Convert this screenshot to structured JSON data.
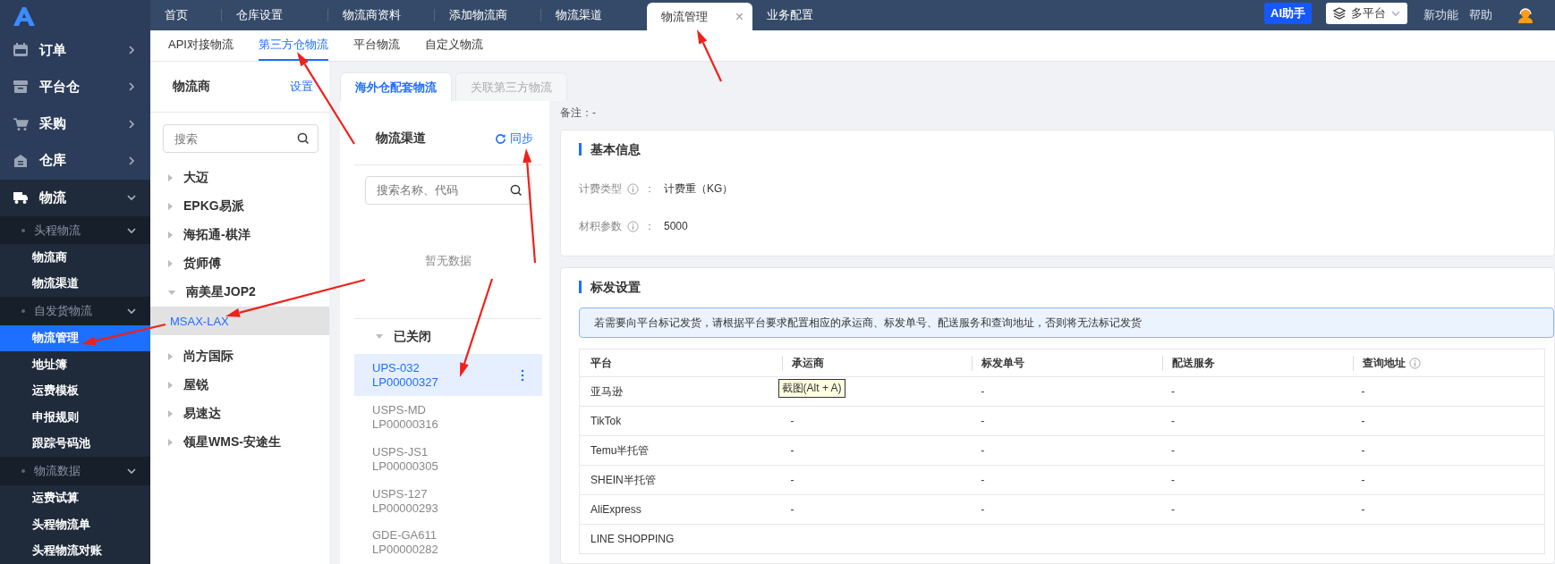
{
  "sidebar": {
    "items": [
      {
        "label": "订单",
        "expanded": false
      },
      {
        "label": "平台仓",
        "expanded": false
      },
      {
        "label": "采购",
        "expanded": false
      },
      {
        "label": "仓库",
        "expanded": false
      },
      {
        "label": "物流",
        "expanded": true,
        "children": [
          {
            "label": "头程物流",
            "expanded": true,
            "children": [
              {
                "label": "物流商",
                "selected": false
              },
              {
                "label": "物流渠道",
                "selected": false
              }
            ]
          },
          {
            "label": "自发货物流",
            "expanded": true,
            "children": [
              {
                "label": "物流管理",
                "selected": true
              },
              {
                "label": "地址簿",
                "selected": false
              },
              {
                "label": "运费模板",
                "selected": false
              },
              {
                "label": "申报规则",
                "selected": false
              },
              {
                "label": "跟踪号码池",
                "selected": false
              }
            ]
          },
          {
            "label": "物流数据",
            "expanded": true,
            "children": [
              {
                "label": "运费试算",
                "selected": false
              },
              {
                "label": "头程物流单",
                "selected": false
              },
              {
                "label": "头程物流对账",
                "selected": false
              }
            ]
          }
        ]
      }
    ]
  },
  "top_tabs": [
    {
      "label": "首页",
      "selected": false
    },
    {
      "label": "仓库设置",
      "selected": false
    },
    {
      "label": "物流商资料",
      "selected": false
    },
    {
      "label": "添加物流商",
      "selected": false
    },
    {
      "label": "物流渠道",
      "selected": false
    },
    {
      "label": "物流管理",
      "selected": true,
      "close": "×"
    },
    {
      "label": "业务配置",
      "selected": false
    }
  ],
  "header_actions": {
    "ai_button": "AI助手",
    "platform_select": "多平台",
    "links": [
      "新功能",
      "帮助"
    ]
  },
  "sub_tabs": [
    {
      "label": "API对接物流",
      "selected": false
    },
    {
      "label": "第三方仓物流",
      "selected": true
    },
    {
      "label": "平台物流",
      "selected": false
    },
    {
      "label": "自定义物流",
      "selected": false
    }
  ],
  "providers": {
    "title": "物流商",
    "settings_link": "设置",
    "search": {
      "placeholder": "搜索"
    },
    "items": [
      {
        "label": "大迈",
        "expanded": false
      },
      {
        "label": "EPKG易派",
        "expanded": false
      },
      {
        "label": "海拓通-棋洋",
        "expanded": false
      },
      {
        "label": "货师傅",
        "expanded": false
      },
      {
        "label": "南美星JOP2",
        "expanded": true,
        "children": [
          {
            "label": "MSAX-LAX",
            "selected": true
          }
        ]
      },
      {
        "label": "尚方国际",
        "expanded": false
      },
      {
        "label": "屋锐",
        "expanded": false
      },
      {
        "label": "易速达",
        "expanded": false
      },
      {
        "label": "领星WMS-安途生",
        "expanded": false
      }
    ]
  },
  "inner_tabs": [
    {
      "label": "海外仓配套物流",
      "selected": true
    },
    {
      "label": "关联第三方物流",
      "selected": false
    }
  ],
  "channels": {
    "title": "物流渠道",
    "sync_link": "同步",
    "search": {
      "placeholder": "搜索名称、代码"
    },
    "empty_text": "暂无数据",
    "group": {
      "label": "已关闭",
      "expanded": true
    },
    "items": [
      {
        "name": "UPS-032",
        "code": "LP00000327",
        "selected": true
      },
      {
        "name": "USPS-MD",
        "code": "LP00000316",
        "selected": false
      },
      {
        "name": "USPS-JS1",
        "code": "LP00000305",
        "selected": false
      },
      {
        "name": "USPS-127",
        "code": "LP00000293",
        "selected": false
      },
      {
        "name": "GDE-GA611",
        "code": "LP00000282",
        "selected": false
      }
    ]
  },
  "detail": {
    "remark": {
      "label": "备注：",
      "value": "-"
    },
    "basic_info": {
      "title": "基本信息",
      "fields": [
        {
          "label": "计费类型",
          "sep": "：",
          "value": "计费重（KG）"
        },
        {
          "label": "材积参数",
          "sep": "：",
          "value": "5000"
        }
      ]
    },
    "marking": {
      "title": "标发设置",
      "notice": "若需要向平台标记发货，请根据平台要求配置相应的承运商、标发单号、配送服务和查询地址，否则将无法标记发货",
      "table": {
        "columns": [
          {
            "label": "平台",
            "info": false
          },
          {
            "label": "承运商",
            "info": false
          },
          {
            "label": "标发单号",
            "info": false
          },
          {
            "label": "配送服务",
            "info": false
          },
          {
            "label": "查询地址",
            "info": true
          }
        ],
        "rows": [
          {
            "cells": [
              "亚马逊",
              null,
              "-",
              "-",
              "-"
            ]
          },
          {
            "cells": [
              "TikTok",
              "-",
              "-",
              "-",
              "-"
            ]
          },
          {
            "cells": [
              "Temu半托管",
              "-",
              "-",
              "-",
              "-"
            ]
          },
          {
            "cells": [
              "SHEIN半托管",
              "-",
              "-",
              "-",
              "-"
            ]
          },
          {
            "cells": [
              "AliExpress",
              "-",
              "-",
              "-",
              "-"
            ]
          },
          {
            "cells": [
              "LINE SHOPPING"
            ]
          }
        ],
        "tooltip": "截图(Alt + A)"
      }
    }
  }
}
